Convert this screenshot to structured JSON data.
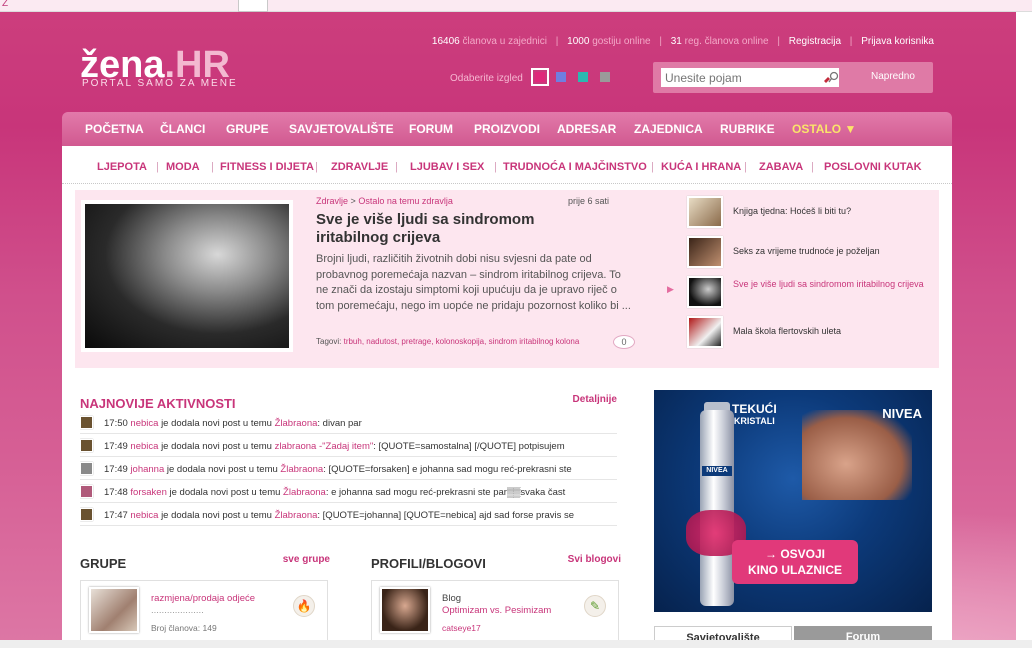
{
  "header": {
    "logo_main": "žena",
    "logo_dot": ".",
    "logo_tld": "HR",
    "tagline": "PORTAL SAMO ZA MENE",
    "stats": {
      "members_count": "16406",
      "members_label": "članova u zajednici",
      "guests_count": "1000",
      "guests_label": "gostiju online",
      "reg_count": "31",
      "reg_label": "reg. članova online",
      "register": "Registracija",
      "login": "Prijava korisnika"
    },
    "theme_label": "Odaberite izgled",
    "theme_colors": [
      "#e0287a",
      "#6f7fe0",
      "#2ab8b0",
      "#9a9a9a"
    ],
    "search_placeholder": "Unesite pojam",
    "advanced": "Napredno"
  },
  "nav": [
    "POČETNA",
    "ČLANCI",
    "GRUPE",
    "SAVJETOVALIŠTE",
    "FORUM",
    "PROIZVODI",
    "ADRESAR",
    "ZAJEDNICA",
    "RUBRIKE",
    "OSTALO ▼"
  ],
  "subnav": [
    "LJEPOTA",
    "MODA",
    "FITNESS I DIJETA",
    "ZDRAVLJE",
    "LJUBAV I SEX",
    "TRUDNOĆA I MAJČINSTVO",
    "KUĆA I HRANA",
    "ZABAVA",
    "POSLOVNI KUTAK"
  ],
  "feature": {
    "crumb_cat": "Zdravlje",
    "crumb_sep": ">",
    "crumb_sub": "Ostalo na temu zdravlja",
    "age": "prije 6 sati",
    "title": "Sve je više ljudi sa sindromom iritabilnog crijeva",
    "body": "Brojni ljudi, različitih životnih dobi nisu svjesni da pate od probavnog poremećaja nazvan – sindrom iritabilnog crijeva. To ne znači da izostaju simptomi koji upućuju da je upravo riječ o tom poremećaju, nego im uopće ne pridaju pozornost koliko bi ...",
    "tags_label": "Tagovi:",
    "tags": "trbuh, nadutost, pretrage, kolonoskopija, sindrom iritabilnog kolona",
    "comments": "0"
  },
  "side_articles": [
    {
      "title": "Knjiga tjedna: Hoćeš li biti tu?"
    },
    {
      "title": "Seks za vrijeme trudnoće je poželjan"
    },
    {
      "title": "Sve je više ljudi sa sindromom iritabilnog crijeva"
    },
    {
      "title": "Mala škola flertovskih uleta"
    }
  ],
  "activity": {
    "title": "NAJNOVIJE AKTIVNOSTI",
    "details": "Detaljnije",
    "rows": [
      {
        "time": "17:50",
        "user": "nebica",
        "action": "je dodala novi post u temu",
        "topic": "Žlabraona",
        "text": ": divan par"
      },
      {
        "time": "17:49",
        "user": "nebica",
        "action": "je dodala novi post u temu",
        "topic": "zlabraona -\"Zadaj item\"",
        "text": ": [QUOTE=samostalna] [/QUOTE] potpisujem"
      },
      {
        "time": "17:49",
        "user": "johanna",
        "action": "je dodala novi post u temu",
        "topic": "Žlabraona",
        "text": ": [QUOTE=forsaken] e johanna sad mogu reć-prekrasni ste"
      },
      {
        "time": "17:48",
        "user": "forsaken",
        "action": "je dodala novi post u temu",
        "topic": "Žlabraona",
        "text": ": e johanna sad mogu reć-prekrasni ste par▒▒svaka čast"
      },
      {
        "time": "17:47",
        "user": "nebica",
        "action": "je dodala novi post u temu",
        "topic": "Žlabraona",
        "text": ": [QUOTE=johanna] [QUOTE=nebica] ajd sad forse pravis se"
      }
    ]
  },
  "grupe": {
    "title": "GRUPE",
    "link": "sve grupe",
    "card_title": "razmjena/prodaja odjeće",
    "card_dots": "....................",
    "card_members": "Broj članova: 149"
  },
  "profili": {
    "title": "PROFILI/BLOGOVI",
    "link": "Svi blogovi",
    "card_type": "Blog",
    "card_title": "Optimizam vs. Pesimizam",
    "card_user": "catseye17"
  },
  "ad": {
    "brand": "NIVEA",
    "line1": "TEKUĆI",
    "line2": "KRISTALI",
    "cta1": "→ OSVOJI",
    "cta2": "KINO ULAZNICE"
  },
  "tabs": [
    "Savjetovalište",
    "Forum"
  ]
}
